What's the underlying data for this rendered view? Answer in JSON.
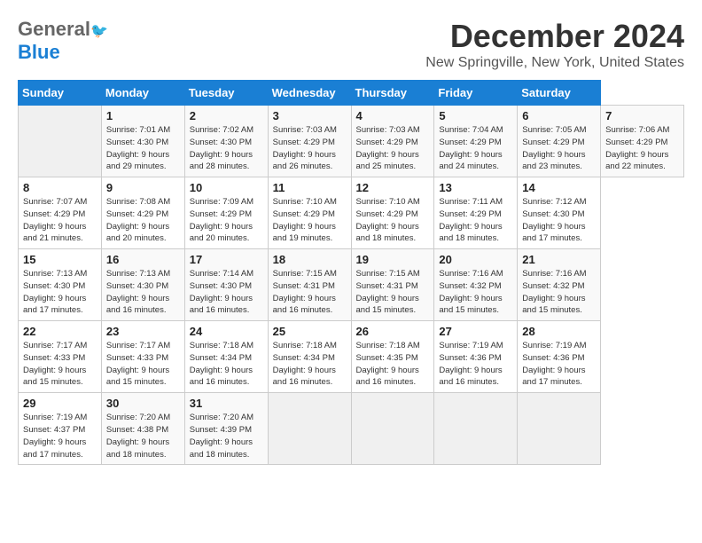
{
  "header": {
    "logo_line1_gray": "General",
    "logo_line1_blue": "Blue",
    "main_title": "December 2024",
    "subtitle": "New Springville, New York, United States"
  },
  "calendar": {
    "days_of_week": [
      "Sunday",
      "Monday",
      "Tuesday",
      "Wednesday",
      "Thursday",
      "Friday",
      "Saturday"
    ],
    "weeks": [
      [
        {
          "day": "",
          "info": "",
          "empty": true
        },
        {
          "day": "1",
          "info": "Sunrise: 7:01 AM\nSunset: 4:30 PM\nDaylight: 9 hours\nand 29 minutes."
        },
        {
          "day": "2",
          "info": "Sunrise: 7:02 AM\nSunset: 4:30 PM\nDaylight: 9 hours\nand 28 minutes."
        },
        {
          "day": "3",
          "info": "Sunrise: 7:03 AM\nSunset: 4:29 PM\nDaylight: 9 hours\nand 26 minutes."
        },
        {
          "day": "4",
          "info": "Sunrise: 7:03 AM\nSunset: 4:29 PM\nDaylight: 9 hours\nand 25 minutes."
        },
        {
          "day": "5",
          "info": "Sunrise: 7:04 AM\nSunset: 4:29 PM\nDaylight: 9 hours\nand 24 minutes."
        },
        {
          "day": "6",
          "info": "Sunrise: 7:05 AM\nSunset: 4:29 PM\nDaylight: 9 hours\nand 23 minutes."
        },
        {
          "day": "7",
          "info": "Sunrise: 7:06 AM\nSunset: 4:29 PM\nDaylight: 9 hours\nand 22 minutes."
        }
      ],
      [
        {
          "day": "8",
          "info": "Sunrise: 7:07 AM\nSunset: 4:29 PM\nDaylight: 9 hours\nand 21 minutes."
        },
        {
          "day": "9",
          "info": "Sunrise: 7:08 AM\nSunset: 4:29 PM\nDaylight: 9 hours\nand 20 minutes."
        },
        {
          "day": "10",
          "info": "Sunrise: 7:09 AM\nSunset: 4:29 PM\nDaylight: 9 hours\nand 20 minutes."
        },
        {
          "day": "11",
          "info": "Sunrise: 7:10 AM\nSunset: 4:29 PM\nDaylight: 9 hours\nand 19 minutes."
        },
        {
          "day": "12",
          "info": "Sunrise: 7:10 AM\nSunset: 4:29 PM\nDaylight: 9 hours\nand 18 minutes."
        },
        {
          "day": "13",
          "info": "Sunrise: 7:11 AM\nSunset: 4:29 PM\nDaylight: 9 hours\nand 18 minutes."
        },
        {
          "day": "14",
          "info": "Sunrise: 7:12 AM\nSunset: 4:30 PM\nDaylight: 9 hours\nand 17 minutes."
        }
      ],
      [
        {
          "day": "15",
          "info": "Sunrise: 7:13 AM\nSunset: 4:30 PM\nDaylight: 9 hours\nand 17 minutes."
        },
        {
          "day": "16",
          "info": "Sunrise: 7:13 AM\nSunset: 4:30 PM\nDaylight: 9 hours\nand 16 minutes."
        },
        {
          "day": "17",
          "info": "Sunrise: 7:14 AM\nSunset: 4:30 PM\nDaylight: 9 hours\nand 16 minutes."
        },
        {
          "day": "18",
          "info": "Sunrise: 7:15 AM\nSunset: 4:31 PM\nDaylight: 9 hours\nand 16 minutes."
        },
        {
          "day": "19",
          "info": "Sunrise: 7:15 AM\nSunset: 4:31 PM\nDaylight: 9 hours\nand 15 minutes."
        },
        {
          "day": "20",
          "info": "Sunrise: 7:16 AM\nSunset: 4:32 PM\nDaylight: 9 hours\nand 15 minutes."
        },
        {
          "day": "21",
          "info": "Sunrise: 7:16 AM\nSunset: 4:32 PM\nDaylight: 9 hours\nand 15 minutes."
        }
      ],
      [
        {
          "day": "22",
          "info": "Sunrise: 7:17 AM\nSunset: 4:33 PM\nDaylight: 9 hours\nand 15 minutes."
        },
        {
          "day": "23",
          "info": "Sunrise: 7:17 AM\nSunset: 4:33 PM\nDaylight: 9 hours\nand 15 minutes."
        },
        {
          "day": "24",
          "info": "Sunrise: 7:18 AM\nSunset: 4:34 PM\nDaylight: 9 hours\nand 16 minutes."
        },
        {
          "day": "25",
          "info": "Sunrise: 7:18 AM\nSunset: 4:34 PM\nDaylight: 9 hours\nand 16 minutes."
        },
        {
          "day": "26",
          "info": "Sunrise: 7:18 AM\nSunset: 4:35 PM\nDaylight: 9 hours\nand 16 minutes."
        },
        {
          "day": "27",
          "info": "Sunrise: 7:19 AM\nSunset: 4:36 PM\nDaylight: 9 hours\nand 16 minutes."
        },
        {
          "day": "28",
          "info": "Sunrise: 7:19 AM\nSunset: 4:36 PM\nDaylight: 9 hours\nand 17 minutes."
        }
      ],
      [
        {
          "day": "29",
          "info": "Sunrise: 7:19 AM\nSunset: 4:37 PM\nDaylight: 9 hours\nand 17 minutes."
        },
        {
          "day": "30",
          "info": "Sunrise: 7:20 AM\nSunset: 4:38 PM\nDaylight: 9 hours\nand 18 minutes."
        },
        {
          "day": "31",
          "info": "Sunrise: 7:20 AM\nSunset: 4:39 PM\nDaylight: 9 hours\nand 18 minutes."
        },
        {
          "day": "",
          "info": "",
          "empty": true
        },
        {
          "day": "",
          "info": "",
          "empty": true
        },
        {
          "day": "",
          "info": "",
          "empty": true
        },
        {
          "day": "",
          "info": "",
          "empty": true
        }
      ]
    ]
  }
}
